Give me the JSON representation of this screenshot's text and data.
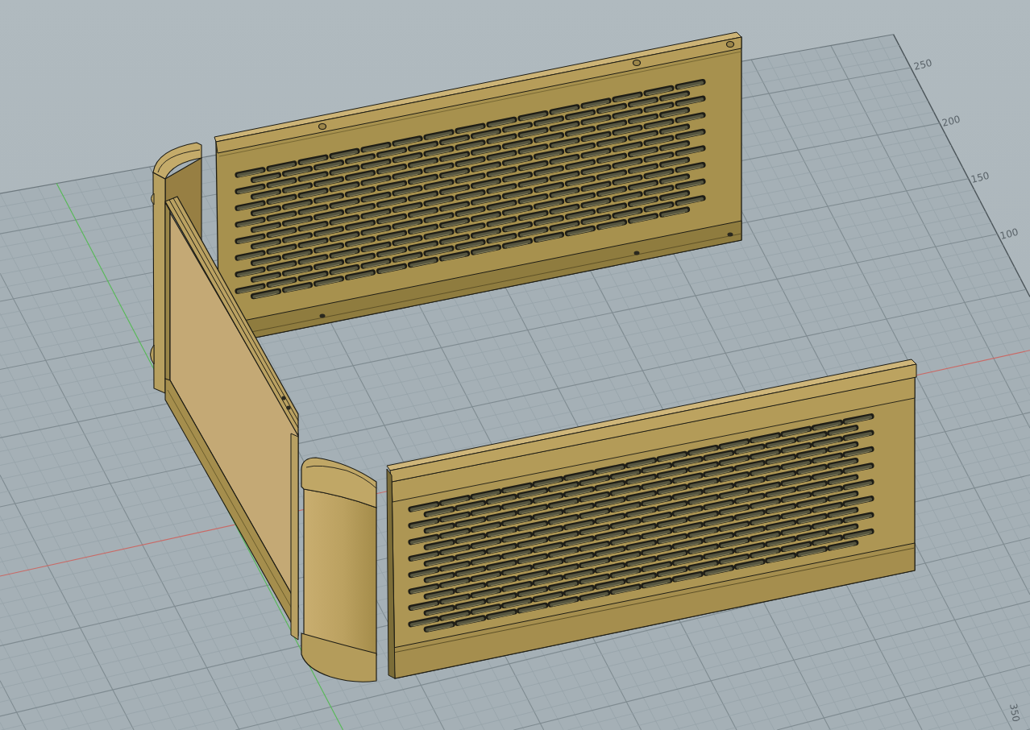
{
  "viewport": {
    "grid_scale": {
      "y_labels": [
        "250",
        "200",
        "150",
        "100"
      ],
      "x_labels": [
        "350"
      ]
    }
  }
}
